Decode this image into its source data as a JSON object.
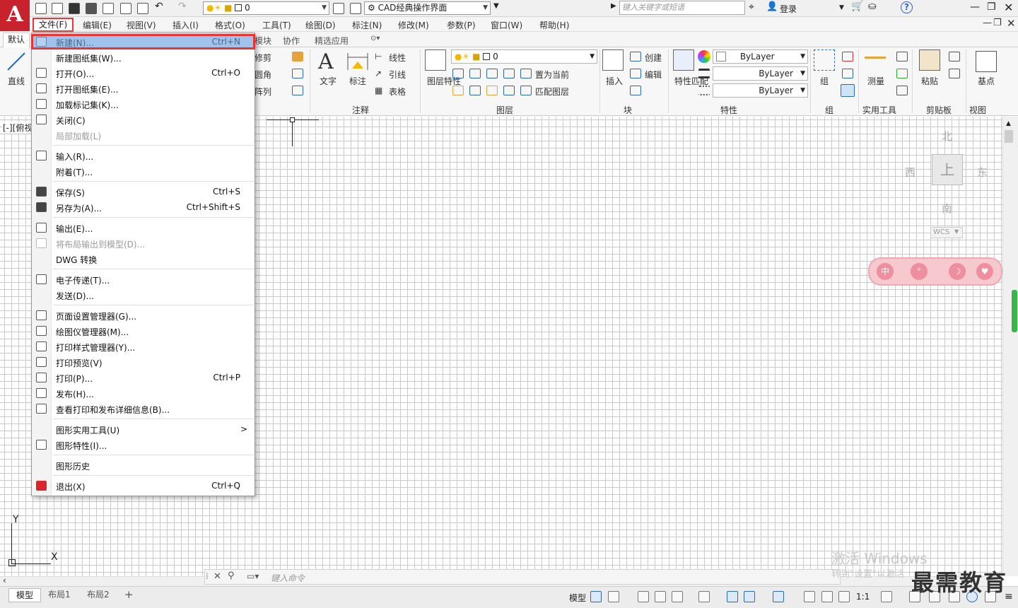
{
  "app": {
    "logo_letter": "A"
  },
  "titlebar": {
    "layer_value": "0",
    "workspace": "CAD经典操作界面",
    "search_placeholder": "键入关键字或短语",
    "login": "登录",
    "help": "?"
  },
  "menubar": [
    "文件(F)",
    "编辑(E)",
    "视图(V)",
    "插入(I)",
    "格式(O)",
    "工具(T)",
    "绘图(D)",
    "标注(N)",
    "修改(M)",
    "参数(P)",
    "窗口(W)",
    "帮助(H)"
  ],
  "ribbon_tabs": [
    "默认",
    "模块",
    "协作",
    "精选应用"
  ],
  "ribbon": {
    "draw_line": "直线",
    "modify": [
      "修剪",
      "圆角",
      "阵列"
    ],
    "annotation": {
      "text": "文字",
      "dim": "标注",
      "linear": "线性",
      "leader": "引线",
      "table": "表格",
      "title": "注释"
    },
    "layers": {
      "props": "图层特性",
      "current_layer": "0",
      "set_current": "置为当前",
      "match": "匹配图层",
      "title": "图层"
    },
    "block": {
      "insert": "插入",
      "create": "创建",
      "edit": "编辑",
      "title": "块"
    },
    "properties": {
      "match": "特性匹配",
      "color": "ByLayer",
      "linetype": "ByLayer",
      "lineweight": "ByLayer",
      "title": "特性"
    },
    "groups": {
      "group": "组",
      "title": "组"
    },
    "utilities": {
      "measure": "测量",
      "title": "实用工具"
    },
    "clipboard": {
      "paste": "粘贴",
      "title": "剪贴板"
    },
    "view": {
      "base": "基点",
      "title": "视图"
    }
  },
  "viewport_label": "[-][俯视",
  "viewcube": {
    "north": "北",
    "south": "南",
    "east": "东",
    "west": "西",
    "top": "上",
    "wcs": "WCS"
  },
  "pink_icons": [
    "中",
    "°",
    "☽",
    "♥"
  ],
  "file_menu": [
    {
      "label": "新建(N)...",
      "shortcut": "Ctrl+N",
      "selected": true
    },
    {
      "label": "新建图纸集(W)..."
    },
    {
      "label": "打开(O)...",
      "shortcut": "Ctrl+O"
    },
    {
      "label": "打开图纸集(E)..."
    },
    {
      "label": "加载标记集(K)..."
    },
    {
      "label": "关闭(C)"
    },
    {
      "label": "局部加载(L)",
      "disabled": true
    },
    {
      "sep": true
    },
    {
      "label": "输入(R)..."
    },
    {
      "label": "附着(T)..."
    },
    {
      "sep": true
    },
    {
      "label": "保存(S)",
      "shortcut": "Ctrl+S"
    },
    {
      "label": "另存为(A)...",
      "shortcut": "Ctrl+Shift+S"
    },
    {
      "sep": true
    },
    {
      "label": "输出(E)..."
    },
    {
      "label": "将布局输出到模型(D)...",
      "disabled": true
    },
    {
      "label": "DWG 转换"
    },
    {
      "sep": true
    },
    {
      "label": "电子传递(T)..."
    },
    {
      "label": "发送(D)..."
    },
    {
      "sep": true
    },
    {
      "label": "页面设置管理器(G)..."
    },
    {
      "label": "绘图仪管理器(M)..."
    },
    {
      "label": "打印样式管理器(Y)..."
    },
    {
      "label": "打印预览(V)"
    },
    {
      "label": "打印(P)...",
      "shortcut": "Ctrl+P"
    },
    {
      "label": "发布(H)..."
    },
    {
      "label": "查看打印和发布详细信息(B)..."
    },
    {
      "sep": true
    },
    {
      "label": "图形实用工具(U)",
      "submenu": ">"
    },
    {
      "label": "图形特性(I)..."
    },
    {
      "sep": true
    },
    {
      "label": "图形历史"
    },
    {
      "sep": true
    },
    {
      "label": "退出(X)",
      "shortcut": "Ctrl+Q"
    }
  ],
  "command_placeholder": "键入命令",
  "layout_tabs": [
    "模型",
    "布局1",
    "布局2",
    "+"
  ],
  "status": {
    "model": "模型",
    "scale": "1:1"
  },
  "watermark": {
    "line1": "激活 Windows",
    "line2": "转到\"设置\"以激活",
    "brand": "最需教育"
  },
  "axis": {
    "y": "Y",
    "x": "X"
  }
}
